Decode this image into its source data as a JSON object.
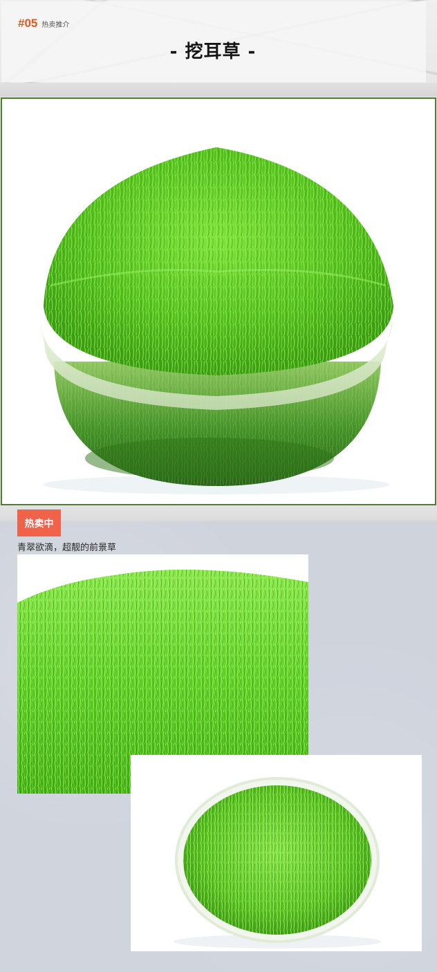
{
  "header": {
    "number": "#05",
    "tag": "热卖推介",
    "title": "- 挖耳草 -"
  },
  "images": {
    "main": {
      "icon": "moss-bowl-photo"
    },
    "closeup": {
      "icon": "moss-closeup-photo"
    },
    "cup": {
      "icon": "moss-cup-photo"
    }
  },
  "promo": {
    "badge": "热卖中",
    "description": "青翠欲滴，超靓的前景草"
  },
  "colors": {
    "accent": "#e4571f",
    "badge": "#f0624a",
    "frame": "#4e7d2f",
    "grass": "#5fd02a"
  }
}
